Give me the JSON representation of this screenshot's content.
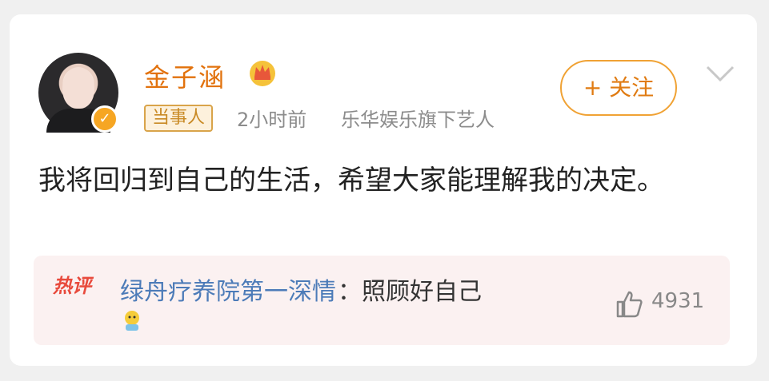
{
  "post": {
    "username": "金子涵",
    "tag": "当事人",
    "time": "2小时前",
    "source": "乐华娱乐旗下艺人",
    "follow_label": "+ 关注",
    "content": "我将回归到自己的生活，希望大家能理解我的决定。"
  },
  "hot_comment": {
    "label": "热评",
    "user": "绿舟疗养院第一深情",
    "text": "：照顾好自己",
    "likes": "4931"
  },
  "colors": {
    "username": "#e2720d",
    "follow_border": "#f0a234",
    "comment_user": "#4c7bb8",
    "hot_label": "#e84a3c",
    "hot_bg": "#fbf1f1"
  },
  "icons": {
    "crown": "crown-icon",
    "verify": "verified-badge-icon",
    "chevron": "chevron-down-icon",
    "like": "thumbs-up-icon",
    "emoji": "emoji-icon"
  }
}
